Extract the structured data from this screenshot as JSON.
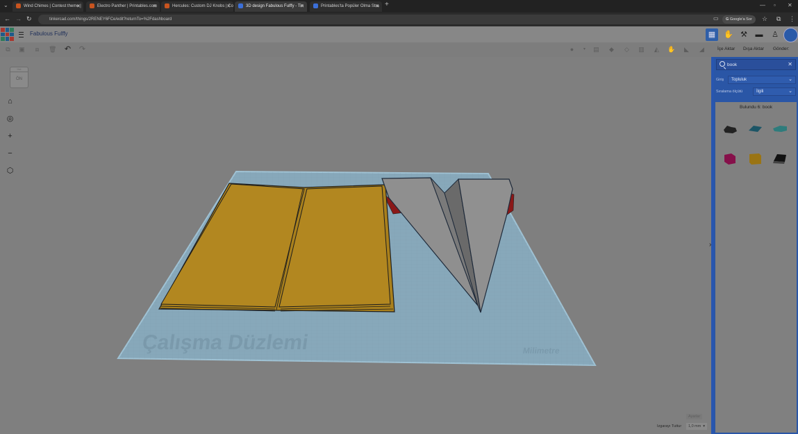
{
  "browser": {
    "tabs": [
      {
        "title": "Wind Chimes | Contest theme |",
        "icon": "printables-favicon"
      },
      {
        "title": "Electro Panther | Printables.com",
        "icon": "printables-favicon"
      },
      {
        "title": "Hercules: Custom DJ Knobs | Co",
        "icon": "printables-favicon"
      },
      {
        "title": "3D design Fabulous Fulffy - Tin",
        "icon": "tinkercad-favicon"
      },
      {
        "title": "Printables'ta Popüler Olma Stra",
        "icon": "gemini-favicon"
      }
    ],
    "url": "tinkercad.com/things/2RENEY6FCe/edit?returnTo=%2Fdashboard",
    "ask_google": "Google'a Sor"
  },
  "app": {
    "design_title": "Fabulous Fulffy",
    "import_label": "İçe Aktar",
    "export_label": "Dışa Aktar",
    "send_label": "Gönder:"
  },
  "viewcube": {
    "top": "Üst",
    "front": "ÖN"
  },
  "workplane": {
    "label": "Çalışma Düzlemi",
    "units": "Milimetre"
  },
  "footer": {
    "settings": "Ayarlar",
    "snap_label": "Izgarayı Tuttur",
    "snap_value": "1,0 mm"
  },
  "panel": {
    "search_value": "book",
    "source_label": "Giriş",
    "source_value": "Topluluk",
    "sort_label": "Sıralama ölçütü",
    "sort_value": "İlgili",
    "found_text": "Bulundu 6: book"
  },
  "colors": {
    "accent": "#2a56a6",
    "book": "#a9801c",
    "plane_accent": "#8a1818"
  }
}
